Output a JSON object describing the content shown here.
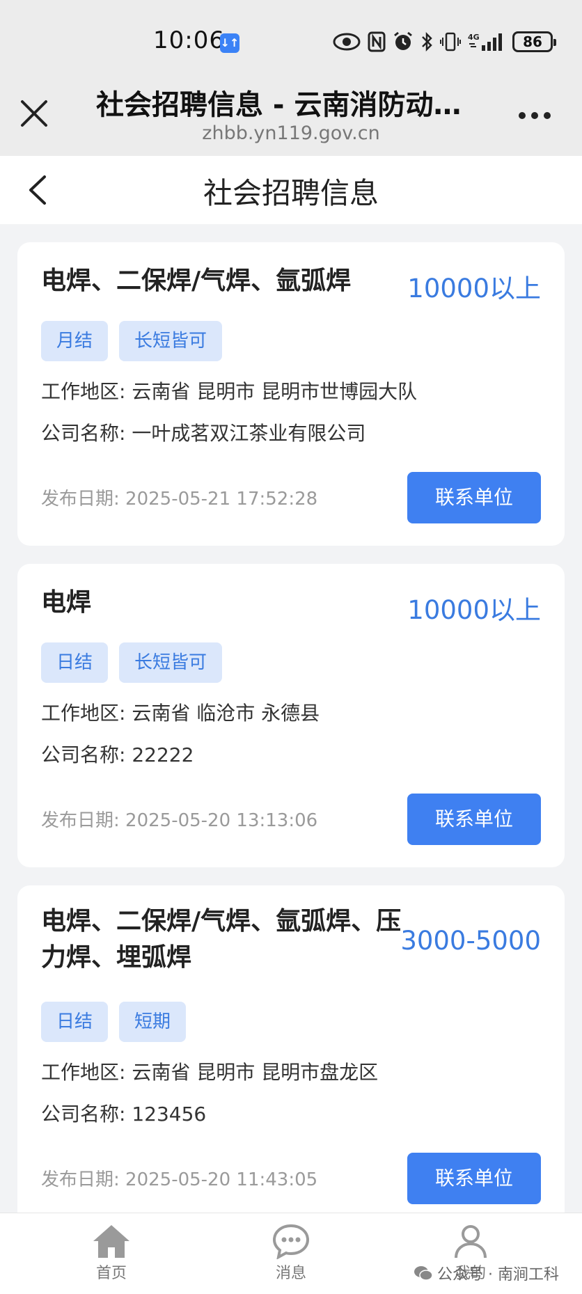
{
  "status_bar": {
    "time": "10:06",
    "data_badge": "↓↑",
    "network": "4G",
    "battery": "86"
  },
  "browser": {
    "title": "社会招聘信息 - 云南消防动…",
    "url": "zhbb.yn119.gov.cn"
  },
  "header": {
    "title": "社会招聘信息"
  },
  "labels": {
    "location": "工作地区:",
    "company": "公司名称:",
    "date": "发布日期:",
    "contact": "联系单位"
  },
  "jobs": [
    {
      "title": "电焊、二保焊/气焊、氩弧焊",
      "salary": "10000以上",
      "tags": [
        "月结",
        "长短皆可"
      ],
      "location": "云南省 昆明市 昆明市世博园大队",
      "company": "一叶成茗双江茶业有限公司",
      "date": "2025-05-21 17:52:28"
    },
    {
      "title": "电焊",
      "salary": "10000以上",
      "tags": [
        "日结",
        "长短皆可"
      ],
      "location": "云南省 临沧市 永德县",
      "company": "22222",
      "date": "2025-05-20 13:13:06"
    },
    {
      "title_line1": "电焊、二保焊/气焊、氩弧焊、压",
      "title_line2": "力焊、埋弧焊",
      "salary": "3000-5000",
      "tags": [
        "日结",
        "短期"
      ],
      "location": "云南省 昆明市 昆明市盘龙区",
      "company": "123456",
      "date": "2025-05-20 11:43:05"
    }
  ],
  "bottom_nav": {
    "home": "首页",
    "messages": "消息",
    "mine": "我的"
  },
  "watermark": "公众号 · 南涧工科",
  "colors": {
    "accent": "#3f80f1",
    "salary": "#3a7be0",
    "tag_bg": "#dbe7fb"
  }
}
